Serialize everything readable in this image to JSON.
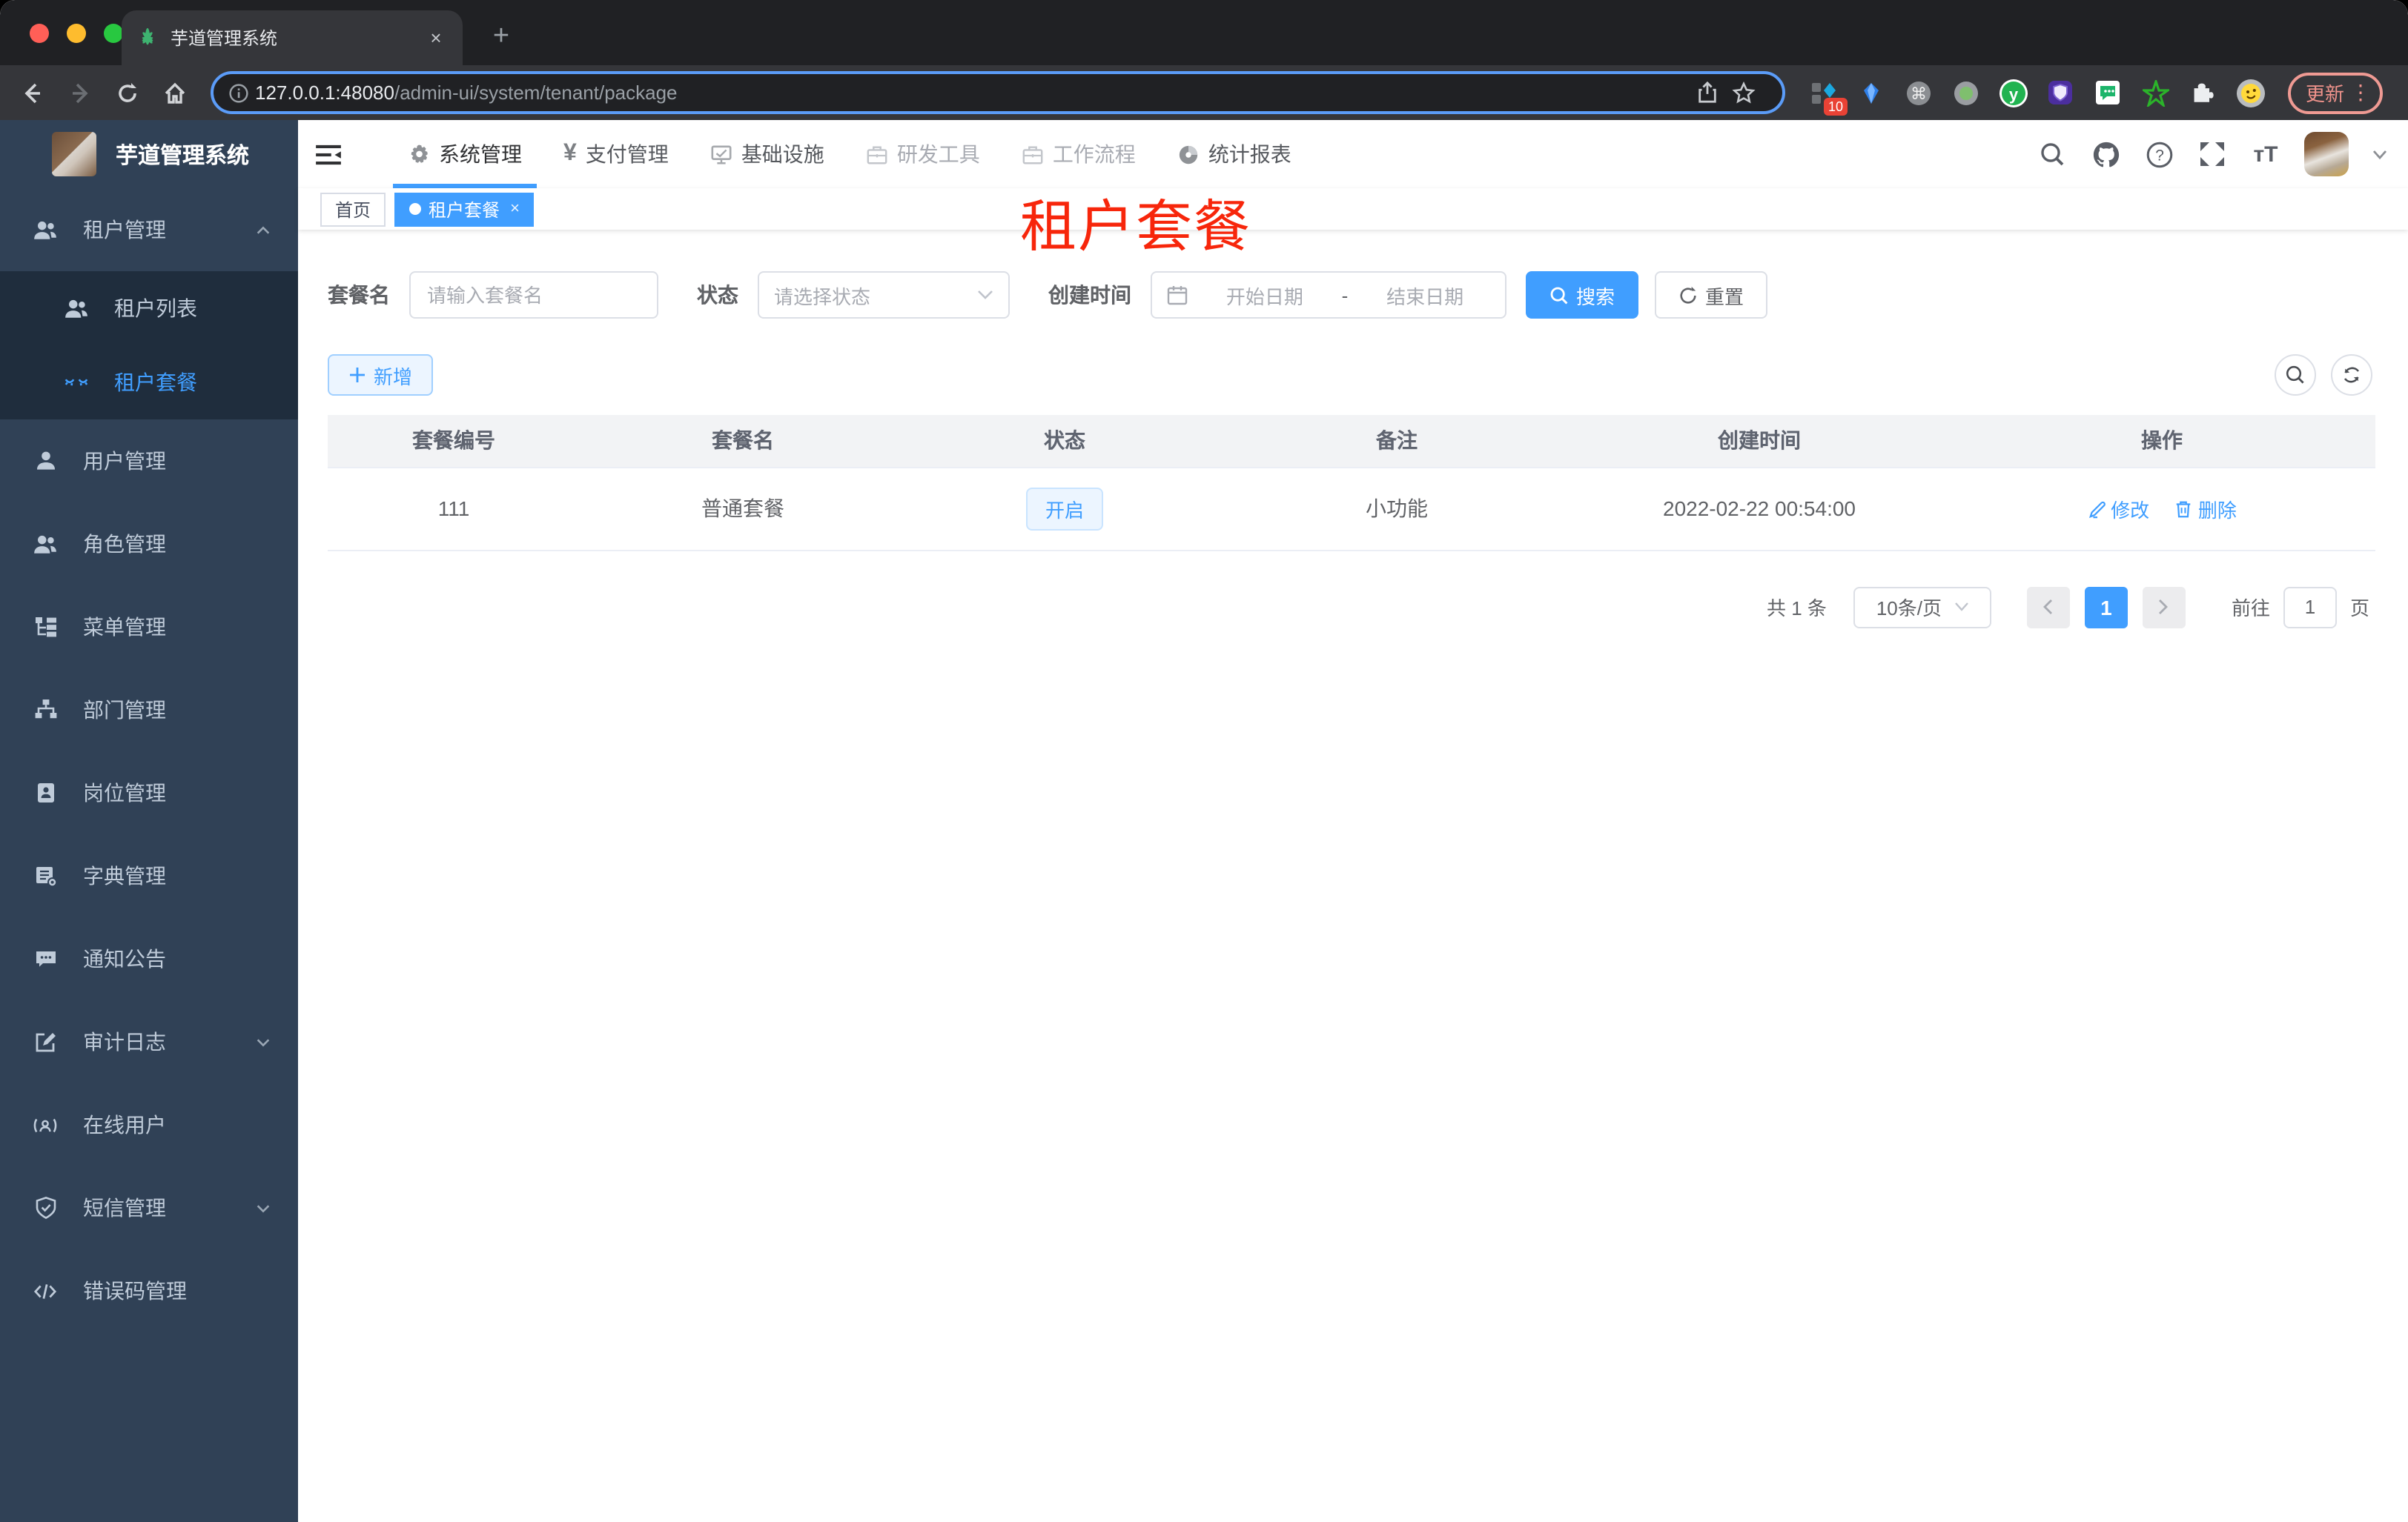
{
  "colors": {
    "accent": "#409eff",
    "overlay_red": "#f7260b",
    "sidebar_bg": "#304156",
    "submenu_bg": "#1f2d3d"
  },
  "browser": {
    "tab_title": "芋道管理系统",
    "close_tab": "×",
    "new_tab": "+",
    "url_host": "127.0.0.1:48080",
    "url_path": "/admin-ui/system/tenant/package",
    "ext_badge_count": "10",
    "update_label": "更新",
    "menu_dots": "⋮"
  },
  "app": {
    "brand": "芋道管理系统",
    "topnav": {
      "items": [
        {
          "label": "系统管理"
        },
        {
          "label": "支付管理"
        },
        {
          "label": "基础设施"
        },
        {
          "label": "研发工具"
        },
        {
          "label": "工作流程"
        },
        {
          "label": "统计报表"
        }
      ]
    },
    "sidebar": {
      "items": [
        {
          "label": "租户管理"
        },
        {
          "label": "租户列表"
        },
        {
          "label": "租户套餐"
        },
        {
          "label": "用户管理"
        },
        {
          "label": "角色管理"
        },
        {
          "label": "菜单管理"
        },
        {
          "label": "部门管理"
        },
        {
          "label": "岗位管理"
        },
        {
          "label": "字典管理"
        },
        {
          "label": "通知公告"
        },
        {
          "label": "审计日志"
        },
        {
          "label": "在线用户"
        },
        {
          "label": "短信管理"
        },
        {
          "label": "错误码管理"
        }
      ]
    },
    "tags": {
      "home": "首页",
      "active": "租户套餐",
      "close": "×"
    },
    "overlay_title": "租户套餐",
    "filters": {
      "name_label": "套餐名",
      "name_placeholder": "请输入套餐名",
      "status_label": "状态",
      "status_placeholder": "请选择状态",
      "time_label": "创建时间",
      "start_placeholder": "开始日期",
      "range_sep": "-",
      "end_placeholder": "结束日期",
      "search_label": "搜索",
      "reset_label": "重置"
    },
    "toolbar": {
      "add_label": "新增"
    },
    "table": {
      "headers": [
        "套餐编号",
        "套餐名",
        "状态",
        "备注",
        "创建时间",
        "操作"
      ],
      "rows": [
        {
          "id": "111",
          "name": "普通套餐",
          "status": "开启",
          "remark": "小功能",
          "created": "2022-02-22 00:54:00",
          "edit": "修改",
          "delete": "删除"
        }
      ]
    },
    "pagination": {
      "total": "共 1 条",
      "page_size": "10条/页",
      "page": "1",
      "goto_prefix": "前往",
      "goto_value": "1",
      "goto_suffix": "页"
    }
  }
}
